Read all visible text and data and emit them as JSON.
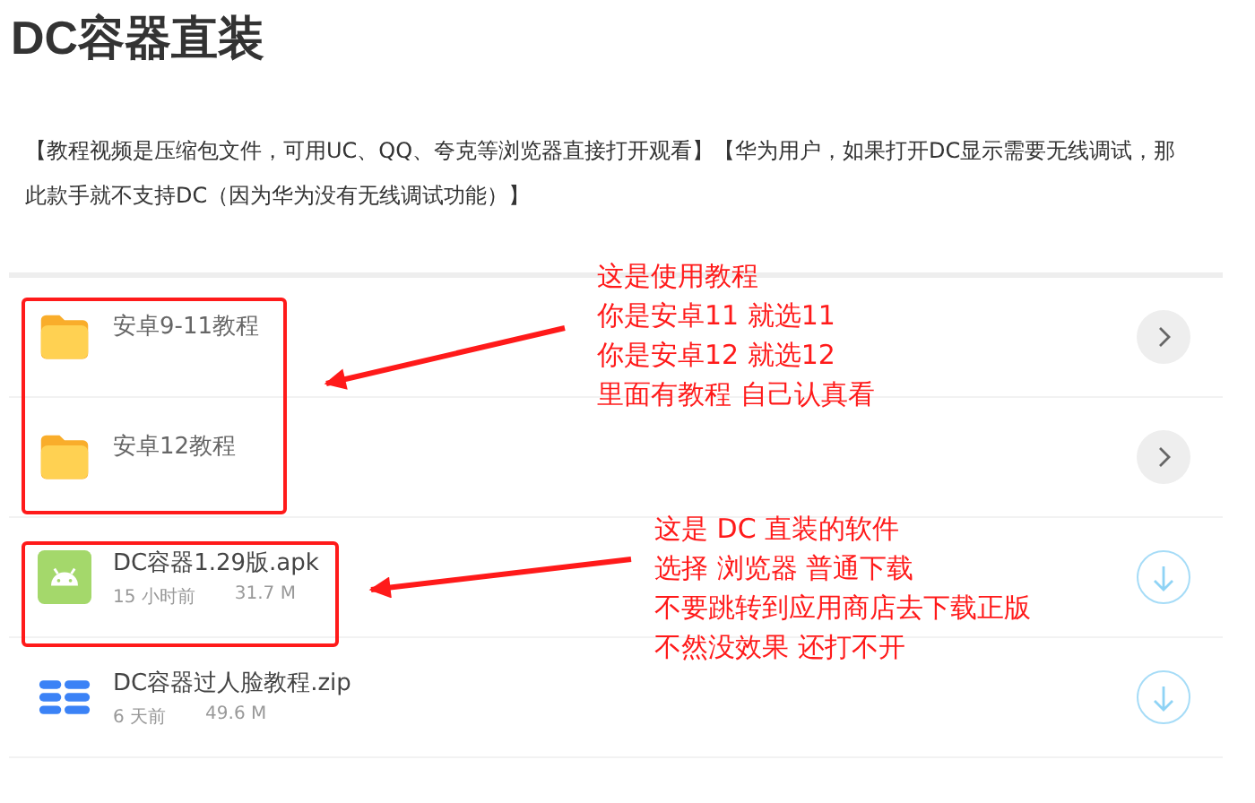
{
  "title": "DC容器直装",
  "notice": "【教程视频是压缩包文件，可用UC、QQ、夸克等浏览器直接打开观看】【华为用户，如果打开DC显示需要无线调试，那此款手就不支持DC（因为华为没有无线调试功能）】",
  "files": [
    {
      "kind": "folder",
      "name": "安卓9-11教程"
    },
    {
      "kind": "folder",
      "name": "安卓12教程"
    },
    {
      "kind": "apk",
      "name": "DC容器1.29版.apk",
      "time": "15 小时前",
      "size": "31.7 M"
    },
    {
      "kind": "zip",
      "name": "DC容器过人脸教程.zip",
      "time": "6 天前",
      "size": "49.6 M"
    }
  ],
  "annotations": [
    {
      "lines": [
        "这是使用教程",
        "你是安卓11 就选11",
        "你是安卓12 就选12",
        "里面有教程 自己认真看"
      ]
    },
    {
      "lines": [
        "这是 DC 直装的软件",
        "选择 浏览器 普通下载",
        "不要跳转到应用商店去下载正版",
        "不然没效果 还打不开"
      ]
    }
  ]
}
